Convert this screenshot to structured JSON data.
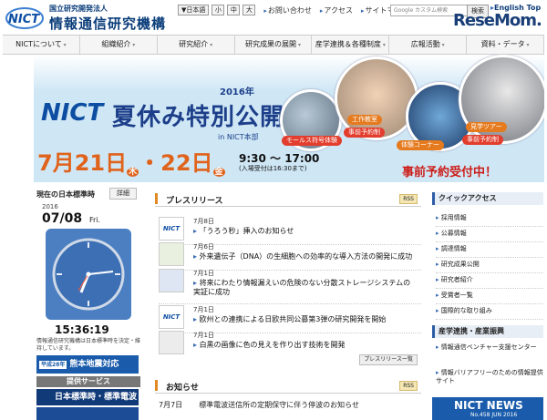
{
  "header": {
    "org_subtitle": "国立研究開発法人",
    "org_name": "情報通信研究機構",
    "logo_text": "NICT",
    "language_select": "▼日本語",
    "font_sizes": [
      "小",
      "中",
      "大"
    ],
    "util_links": [
      "お問い合わせ",
      "アクセス",
      "サイトマップ"
    ],
    "search_placeholder": "Google カスタム検索",
    "search_button": "検索",
    "english_link": "English Top",
    "watermark": "ReseMom."
  },
  "nav": {
    "items": [
      "NICTについて",
      "組織紹介",
      "研究紹介",
      "研究成果の展開",
      "産学連携＆各種制度",
      "広報活動",
      "資料・データ"
    ]
  },
  "banner": {
    "nict": "NICT",
    "year": "2016年",
    "title": "夏休み特別公開",
    "venue": "in NICT本部",
    "date_main": "7月21日",
    "date_day1": "木",
    "date_sep": "・",
    "date_main2": "22日",
    "date_day2": "金",
    "time": "9:30 ～ 17:00",
    "time_note": "(入場受付は16:30まで)",
    "reservation": "事前予約受付中！",
    "tags": [
      "モールス符号体験",
      "工作教室",
      "事前予約制",
      "体験コーナー",
      "見学ツアー",
      "事前予約制"
    ]
  },
  "jst": {
    "heading": "現在の日本標準時",
    "detail_button": "詳細",
    "year": "2016",
    "date": "07/08",
    "day": "Fri.",
    "time": "15:36:19",
    "note": "情報通信研究機構は日本標準時を決定・維持しています。",
    "quake_year": "平成28年",
    "quake_banner": "熊本地震対応",
    "services_heading": "提供サービス",
    "service_1": "日本標準時・標準電波"
  },
  "press": {
    "heading": "プレスリリース",
    "rss": "RSS",
    "items": [
      {
        "date": "7月8日",
        "title": "「うろう秒」挿入のお知らせ"
      },
      {
        "date": "7月6日",
        "title": "外来遺伝子（DNA）の生細胞への効率的な導入方法の開発に成功"
      },
      {
        "date": "7月1日",
        "title": "将来にわたり情報漏えいの危険のない分散ストレージシステムの実証に成功"
      },
      {
        "date": "7月1日",
        "title": "欧州との連携による日欧共同公募第3弾の研究開発を開始"
      },
      {
        "date": "7月1日",
        "title": "白黒の画像に色の見えを作り出す技術を開発"
      }
    ],
    "list_button": "プレスリリース一覧"
  },
  "notices": {
    "heading": "お知らせ",
    "rss": "RSS",
    "first_date": "7月7日",
    "first_title": "標準電波送信所の定期保守に伴う停波のお知らせ"
  },
  "quick_access": {
    "heading": "クイックアクセス",
    "items": [
      "採用情報",
      "公募情報",
      "調達情報",
      "研究成果公開",
      "研究者紹介",
      "受賞者一覧",
      "国際的な取り組み"
    ]
  },
  "industry": {
    "heading": "産学連携・産業振興",
    "items": [
      "情報通信ベンチャー支援センター",
      "情報バリアフリーのための情報提供サイト"
    ]
  },
  "nict_news": {
    "title": "NICT NEWS",
    "issue": "No.458 JUN 2016"
  },
  "colors": {
    "brand_blue": "#0d4ea2",
    "accent_orange": "#e0631c",
    "reserve_red": "#cc1d18"
  }
}
